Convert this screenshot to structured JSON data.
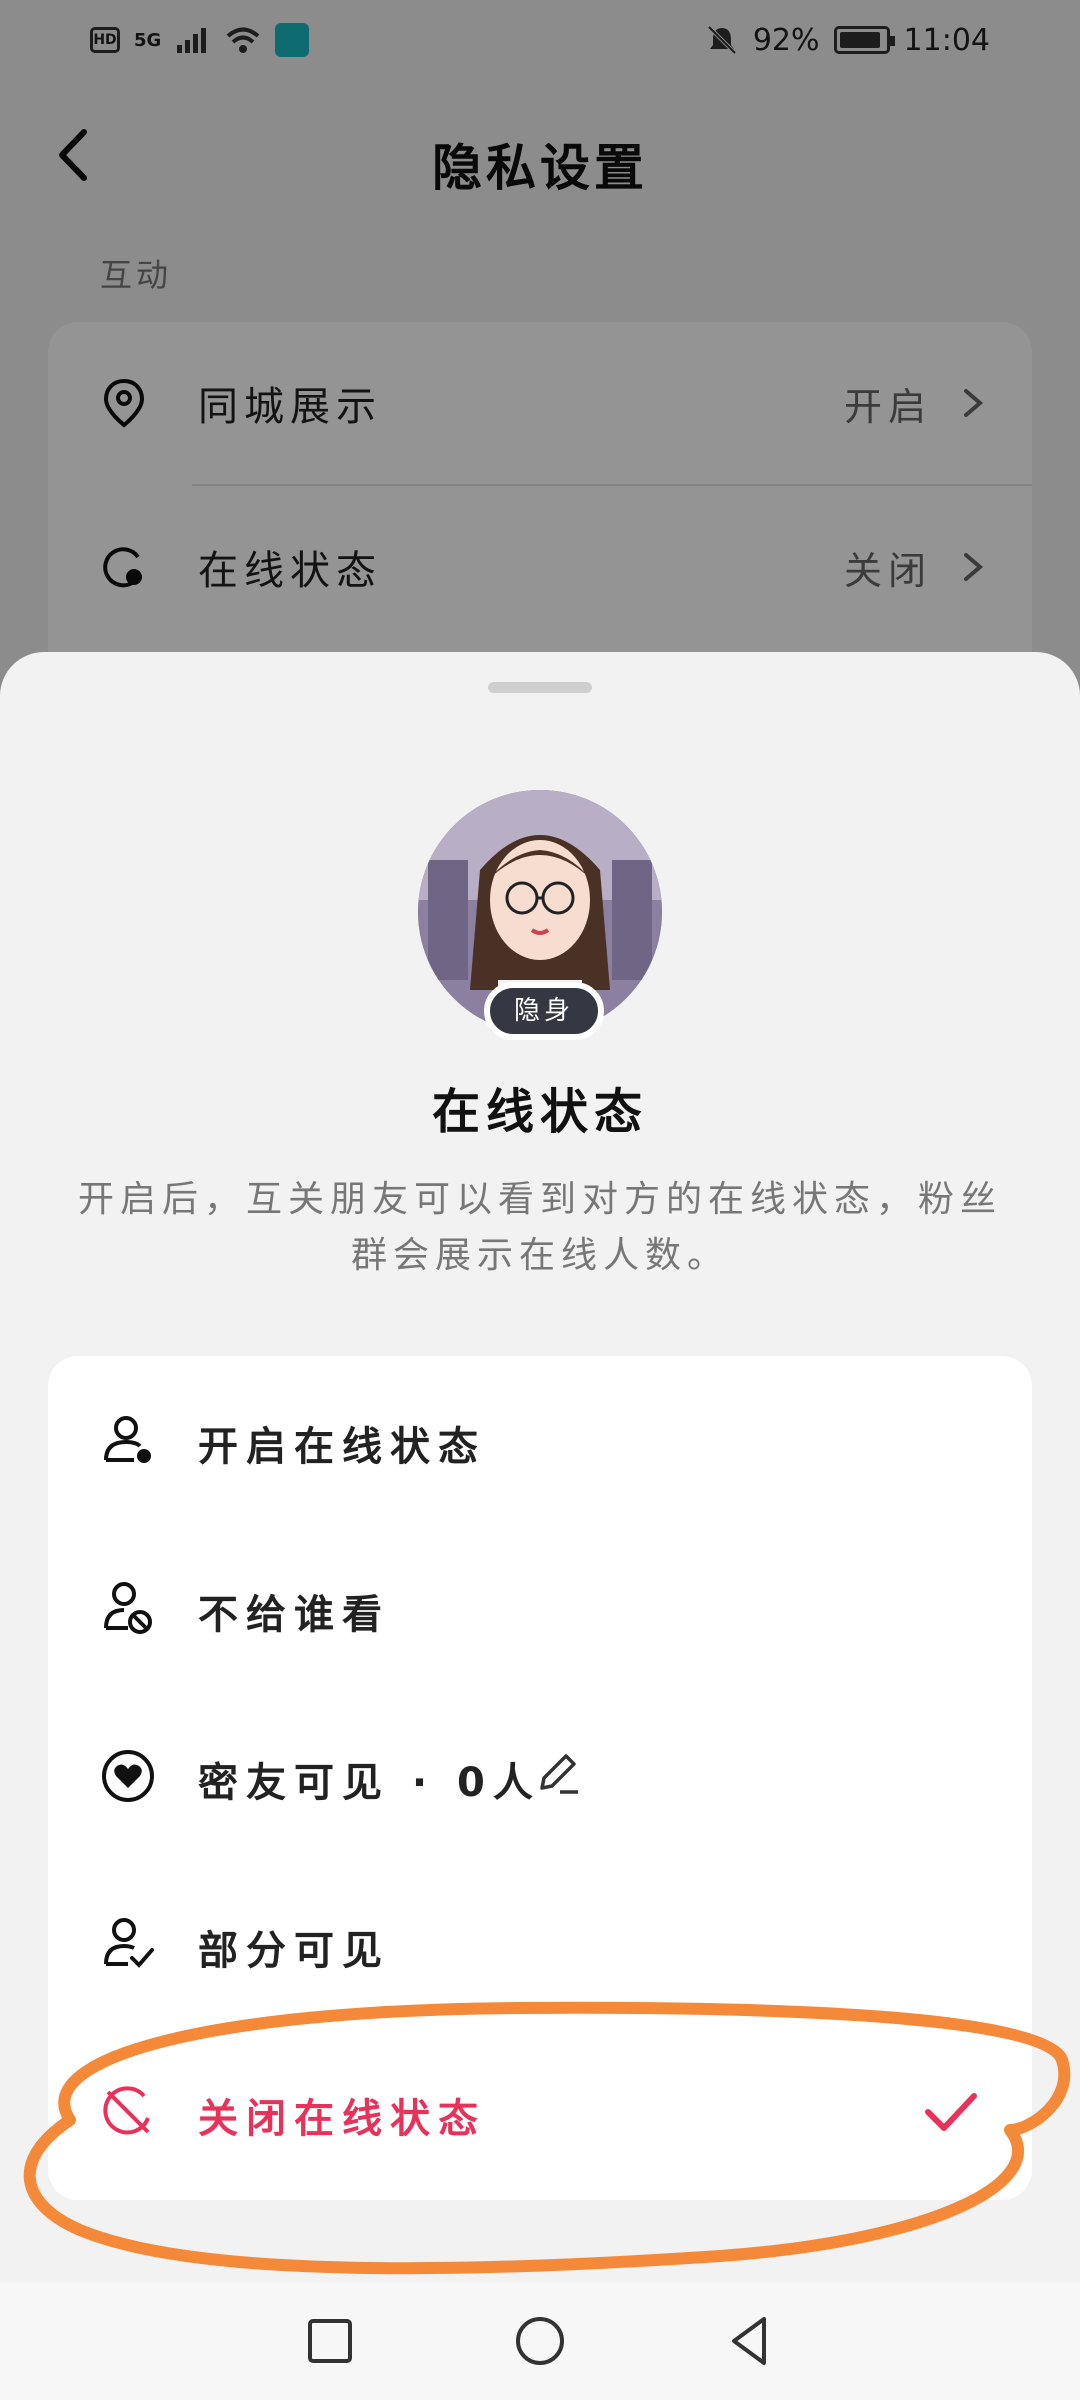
{
  "status_bar": {
    "hd_label": "HD",
    "network_label": "5G",
    "battery_percent": "92%",
    "battery_level": 0.92,
    "time": "11:04",
    "icons": [
      "signal-icon",
      "wifi-icon",
      "vpn-icon",
      "mute-bell-icon",
      "battery-icon"
    ]
  },
  "header": {
    "title": "隐私设置",
    "back_icon": "chevron-left-icon"
  },
  "interaction_section": {
    "label": "互动",
    "rows": [
      {
        "icon": "location-pin-icon",
        "label": "同城展示",
        "value": "开启"
      },
      {
        "icon": "online-status-icon",
        "label": "在线状态",
        "value": "关闭"
      }
    ]
  },
  "sheet": {
    "avatar_badge": "隐身",
    "title": "在线状态",
    "description": "开启后，互关朋友可以看到对方的在线状态，粉丝群会展示在线人数。",
    "options": [
      {
        "icon": "person-online-icon",
        "label": "开启在线状态",
        "selected": false
      },
      {
        "icon": "person-blocked-icon",
        "label": "不给谁看",
        "selected": false
      },
      {
        "icon": "heart-circle-icon",
        "label": "密友可见 · 0人",
        "selected": false
      },
      {
        "icon": "person-check-icon",
        "label": "部分可见",
        "selected": false
      },
      {
        "icon": "hidden-status-icon",
        "label": "关闭在线状态",
        "selected": true
      }
    ]
  },
  "colors": {
    "accent": "#e8325a",
    "annotation": "#f5893a",
    "badge_bg": "#353842"
  },
  "nav_bar": {
    "icons": [
      "recent-apps-square-icon",
      "home-circle-icon",
      "back-triangle-icon"
    ]
  }
}
